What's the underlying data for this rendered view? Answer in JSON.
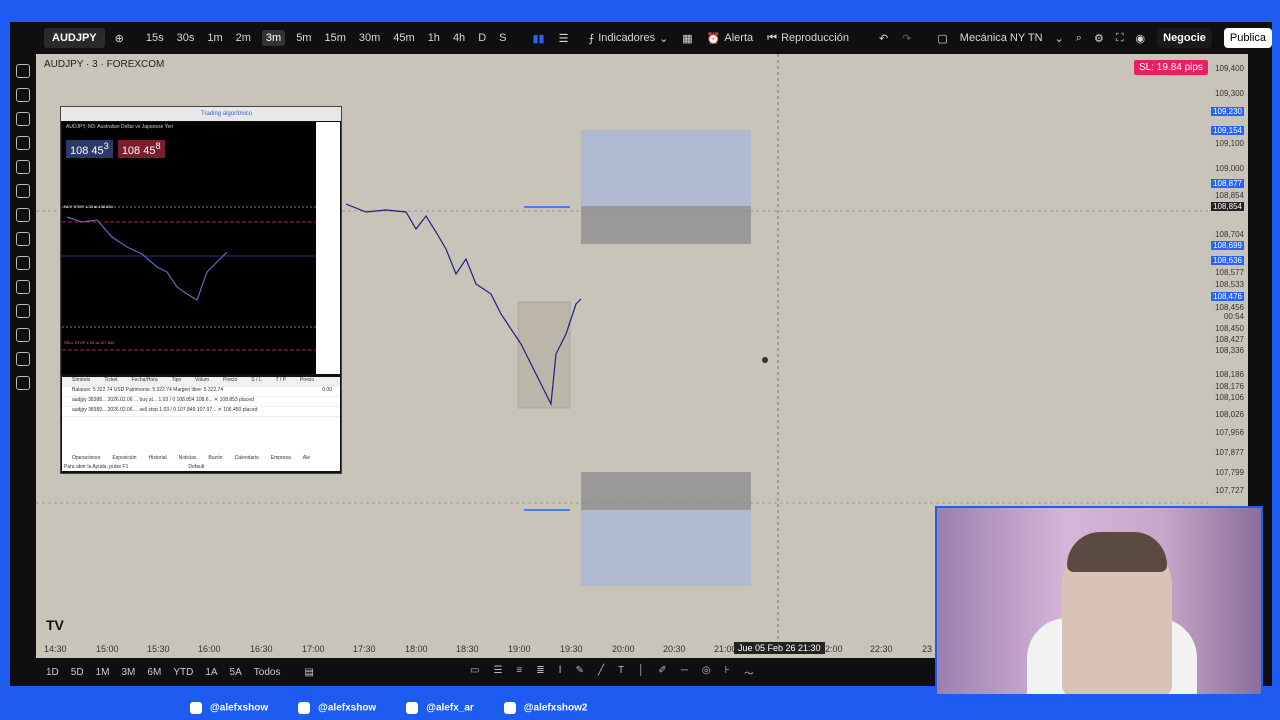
{
  "toolbar": {
    "symbol": "AUDJPY",
    "timeframes": [
      "15s",
      "30s",
      "1m",
      "2m",
      "3m",
      "5m",
      "15m",
      "30m",
      "45m",
      "1h",
      "4h",
      "D",
      "S"
    ],
    "active_timeframe": "3m",
    "indicators_label": "Indicadores",
    "alert_label": "Alerta",
    "replay_label": "Reproducción",
    "template_label": "Mecánica NY TN",
    "trade_button": "Negocie",
    "publish_button": "Publica"
  },
  "chart": {
    "title": "AUDJPY · 3 · FOREXCOM",
    "sl_badge": "SL: 19.84 pips",
    "price_labels": [
      "109,400",
      "109,300",
      "109,230",
      "109,154",
      "109,100",
      "109,000",
      "108,877",
      "108,854",
      "108,854",
      "108,704",
      "108,699",
      "108,636",
      "108,577",
      "108,533",
      "108,476",
      "108,456",
      "00:54",
      "108,450",
      "108,427",
      "108,336",
      "108,186",
      "108,176",
      "108,106",
      "108,026",
      "107,956",
      "107,877",
      "107,799",
      "107,727"
    ],
    "time_labels": [
      "14:30",
      "15:00",
      "15:30",
      "16:00",
      "16:30",
      "17:00",
      "17:30",
      "18:00",
      "18:30",
      "19:00",
      "19:30",
      "20:00",
      "20:30",
      "21:00",
      "Jue 05 Feb 26  21:30",
      "22:00",
      "22:30",
      "23"
    ]
  },
  "mt_window": {
    "title": "AUDJPY, M3: Australian Dollar vs Japanese Yen",
    "algo_label": "Trading algorítmico",
    "sell_price": "108 45",
    "sell_sup": "3",
    "buy_price": "108 45",
    "buy_sup": "8",
    "buy_stop_label": "BUY STOP 1.03 at 108.854",
    "sell_stop_label": "SELL STOP 1.03 at 107.849",
    "columns": [
      "Símbolo",
      "Ticket",
      "Fecha/Hora",
      "Tipo",
      "Volum",
      "Precio",
      "S / L",
      "T / P",
      "Precio"
    ],
    "balance_row": "Balance: 5 322.74 USD  Patrimonio: 5 322.74  Margen libre: 5 322.74",
    "balance_value": "0.00",
    "orders": [
      "audjpy  38388...  2026.02.06 ...  buy st...  1.03 / 0   108.854  108.6...  ✕  108.853  placed",
      "audjpy  38389...  2026.02.06 ...  sell stop  1.03 / 0   107.849  107.97...  ✕  106.450  placed"
    ],
    "tabs": [
      "Operaciones",
      "Exposición",
      "Historial",
      "Noticias",
      "Buzón",
      "Calendario",
      "Empresa",
      "Ale"
    ],
    "status": "Para abrir la Ayuda, pulse F1",
    "status_default": "Default"
  },
  "bottombar": {
    "ranges": [
      "1D",
      "5D",
      "1M",
      "3M",
      "6M",
      "YTD",
      "1A",
      "5A",
      "Todos"
    ]
  },
  "social": [
    {
      "icon": "tiktok-icon",
      "handle": "@alefxshow"
    },
    {
      "icon": "x-icon",
      "handle": "@alefxshow"
    },
    {
      "icon": "instagram-icon",
      "handle": "@alefx_ar"
    },
    {
      "icon": "youtube-icon",
      "handle": "@alefxshow2"
    }
  ],
  "colors": {
    "accent": "#2962ff",
    "sl_badge": "#e91e63",
    "frame": "#1e5bf0",
    "chart_bg": "#c9c4ba"
  }
}
